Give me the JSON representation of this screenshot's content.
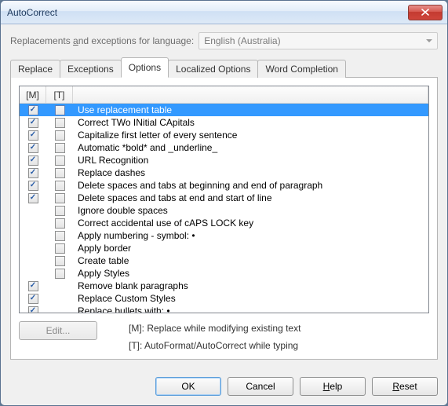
{
  "window": {
    "title": "AutoCorrect"
  },
  "lang": {
    "label_pre": "Replacements ",
    "label_underlined": "a",
    "label_post": "nd exceptions for language:",
    "value": "English (Australia)"
  },
  "tabs": {
    "replace": "Replace",
    "exceptions": "Exceptions",
    "options": "Options",
    "localized": "Localized Options",
    "wordcomp": "Word Completion"
  },
  "headers": {
    "m": "[M]",
    "t": "[T]"
  },
  "rows": [
    {
      "m": true,
      "t": false,
      "label": "Use replacement table",
      "selected": true
    },
    {
      "m": true,
      "t": false,
      "label": "Correct TWo INitial CApitals"
    },
    {
      "m": true,
      "t": false,
      "label": "Capitalize first letter of every sentence"
    },
    {
      "m": true,
      "t": false,
      "label": "Automatic *bold* and _underline_"
    },
    {
      "m": true,
      "t": false,
      "label": "URL Recognition"
    },
    {
      "m": true,
      "t": false,
      "label": "Replace dashes"
    },
    {
      "m": true,
      "t": false,
      "label": "Delete spaces and tabs at beginning and end of paragraph"
    },
    {
      "m": true,
      "t": false,
      "label": "Delete spaces and tabs at end and start of line"
    },
    {
      "m": null,
      "t": false,
      "label": "Ignore double spaces"
    },
    {
      "m": null,
      "t": false,
      "label": "Correct accidental use of cAPS LOCK key"
    },
    {
      "m": null,
      "t": false,
      "label": "Apply numbering - symbol: •"
    },
    {
      "m": null,
      "t": false,
      "label": "Apply border"
    },
    {
      "m": null,
      "t": false,
      "label": "Create table"
    },
    {
      "m": null,
      "t": false,
      "label": "Apply Styles"
    },
    {
      "m": true,
      "t": null,
      "label": "Remove blank paragraphs"
    },
    {
      "m": true,
      "t": null,
      "label": "Replace Custom Styles"
    },
    {
      "m": true,
      "t": null,
      "label": "Replace bullets with: •"
    }
  ],
  "edit_label": "Edit...",
  "legend": {
    "m": "[M]: Replace while modifying existing text",
    "t": "[T]: AutoFormat/AutoCorrect while typing"
  },
  "buttons": {
    "ok": "OK",
    "cancel": "Cancel",
    "help_pre": "",
    "help_u": "H",
    "help_post": "elp",
    "reset_pre": "",
    "reset_u": "R",
    "reset_post": "eset"
  }
}
